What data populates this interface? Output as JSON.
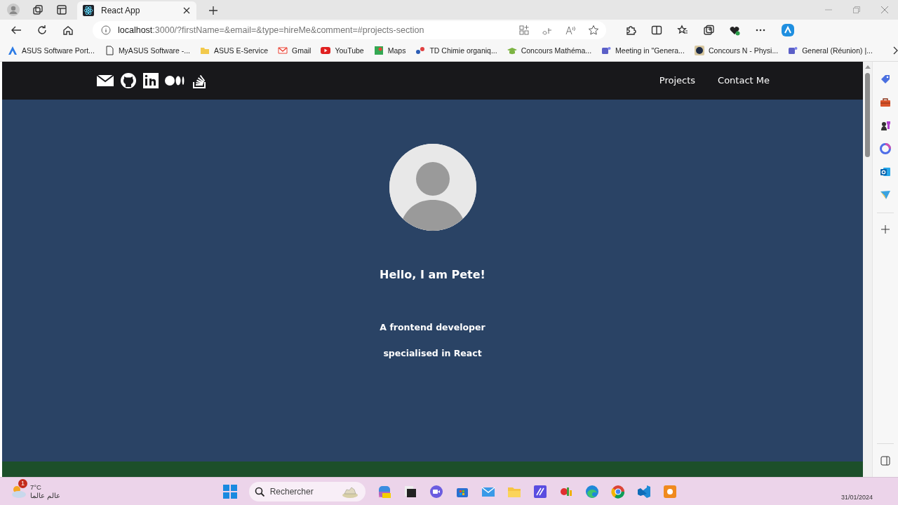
{
  "browser": {
    "tabs": [
      {
        "title": "React App",
        "selected": true
      }
    ],
    "address": {
      "host": "localhost",
      "path": ":3000/?firstName=&email=&type=hireMe&comment=#projects-section"
    },
    "bookmarks": [
      {
        "label": "ASUS Software Port...",
        "kind": "triangle"
      },
      {
        "label": "MyASUS Software -...",
        "kind": "document"
      },
      {
        "label": "ASUS E-Service",
        "kind": "folder"
      },
      {
        "label": "Gmail",
        "kind": "envelope"
      },
      {
        "label": "YouTube",
        "kind": "play"
      },
      {
        "label": "Maps",
        "kind": "pin"
      },
      {
        "label": "TD Chimie organiq...",
        "kind": "app"
      },
      {
        "label": "Concours Mathéma...",
        "kind": "cap"
      },
      {
        "label": "Meeting in \"Genera...",
        "kind": "team"
      },
      {
        "label": "Concours N - Physi...",
        "kind": "disc"
      },
      {
        "label": "General (Réunion) |...",
        "kind": "team"
      }
    ]
  },
  "page": {
    "nav_links": [
      {
        "label": "Projects"
      },
      {
        "label": "Contact Me"
      }
    ],
    "greeting": "Hello, I am Pete!",
    "bio_lines": [
      "A frontend developer",
      "specialised in React"
    ]
  },
  "taskbar": {
    "weather": {
      "badge": "1",
      "temperature": "7°C",
      "caption": "عالم عالما"
    },
    "search": {
      "placeholder": "Rechercher"
    },
    "date": "31/01/2024"
  }
}
